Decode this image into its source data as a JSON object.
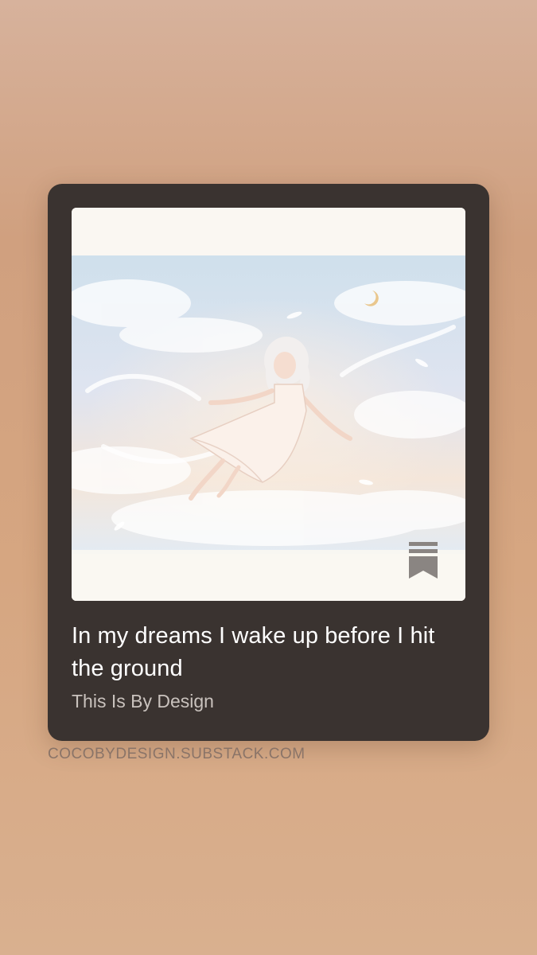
{
  "card": {
    "title": "In my dreams I wake up before I hit the ground",
    "publication": "This Is By Design",
    "image_alt": "Watercolor illustration of a girl in a white dress floating among pastel clouds under a crescent moon",
    "bookmark_icon": "substack-bookmark-icon"
  },
  "footer": {
    "domain": "COCOBYDESIGN.SUBSTACK.COM"
  },
  "colors": {
    "card_background": "#3a3330",
    "title": "#ffffff",
    "publication": "#c9c2bd",
    "domain": "#8a7468"
  }
}
